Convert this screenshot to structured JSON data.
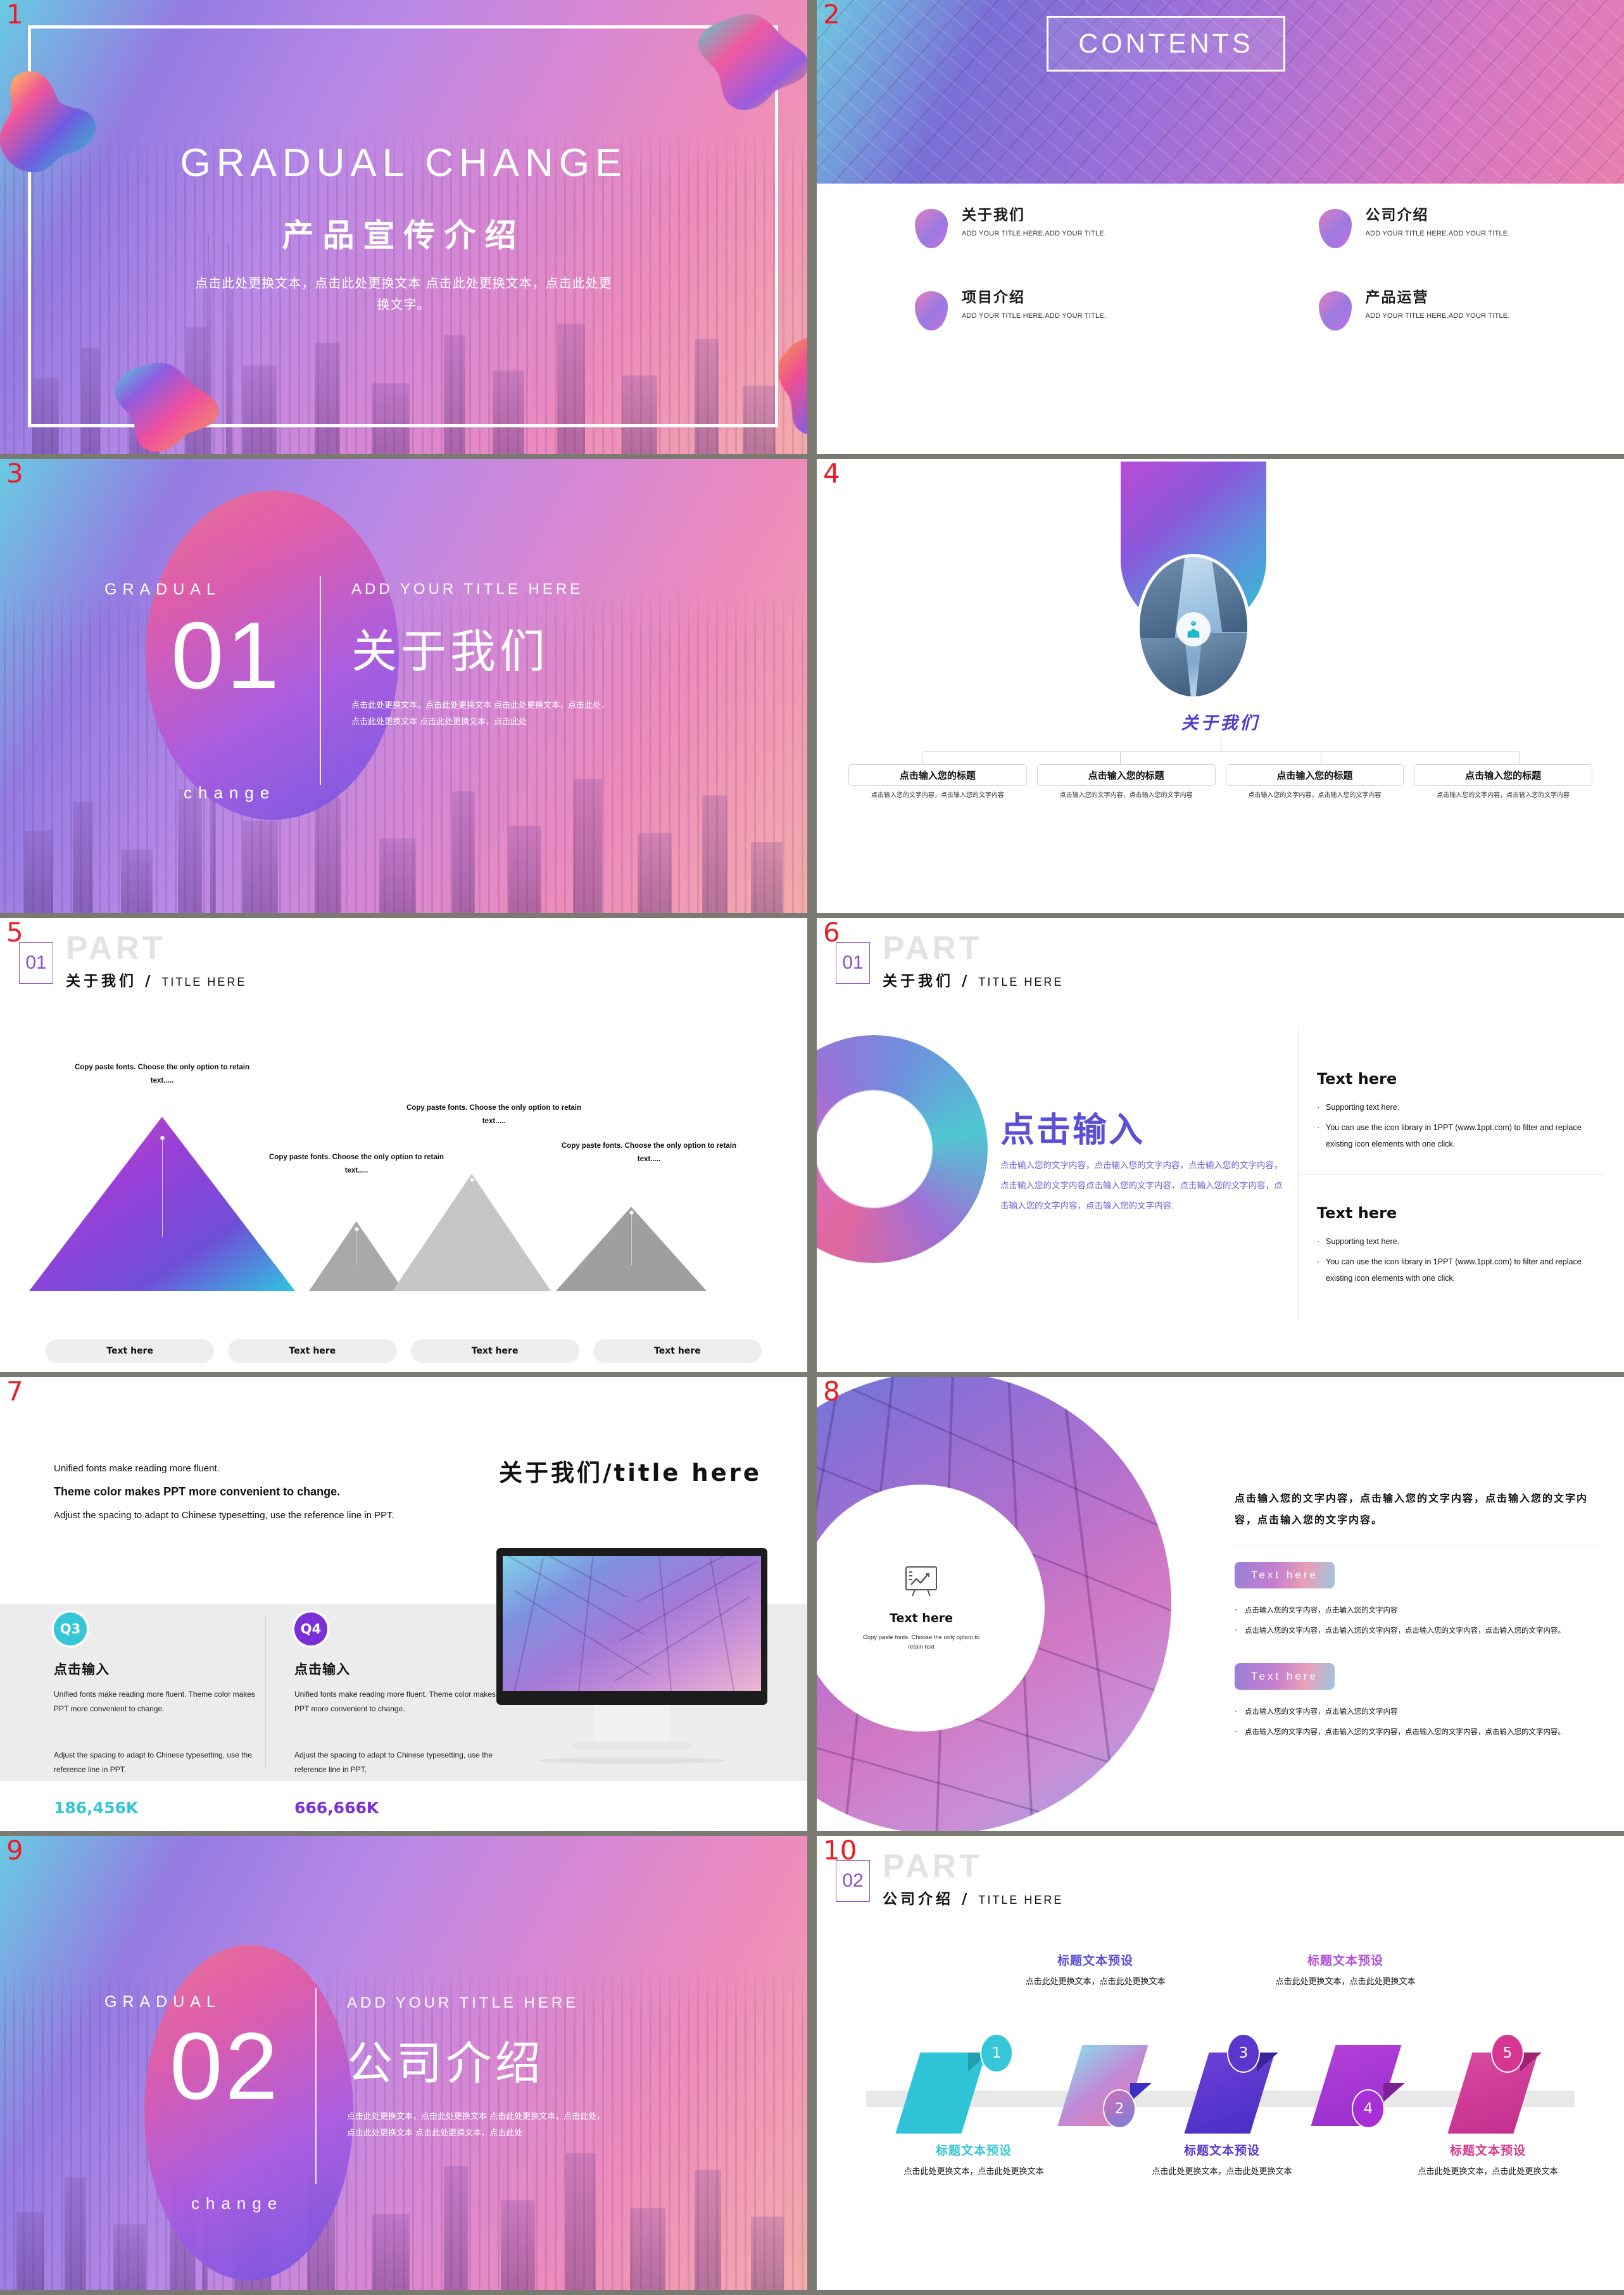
{
  "meta": {
    "slide_numbers": [
      "1",
      "2",
      "3",
      "4",
      "5",
      "6",
      "7",
      "8",
      "9",
      "10"
    ],
    "accent_purple": "#8c4fc2",
    "accent_indigo": "#5b4fd6",
    "number_color": "#ec1c24"
  },
  "slide1": {
    "title_en": "GRADUAL CHANGE",
    "title_cn": "产品宣传介绍",
    "desc": "点击此处更换文本，点击此处更换文本 点击此处更换文本，点击此处更换文字。"
  },
  "slide2": {
    "heading": "CONTENTS",
    "items": [
      {
        "title": "关于我们",
        "sub": "ADD YOUR TITLE HERE.ADD YOUR TITLE."
      },
      {
        "title": "公司介绍",
        "sub": "ADD YOUR TITLE HERE.ADD YOUR TITLE."
      },
      {
        "title": "项目介绍",
        "sub": "ADD YOUR TITLE HERE.ADD YOUR TITLE."
      },
      {
        "title": "产品运营",
        "sub": "ADD YOUR TITLE HERE.ADD YOUR TITLE."
      }
    ]
  },
  "slide3": {
    "gradual": "GRADUAL",
    "number": "01",
    "change": "change",
    "add_title": "ADD YOUR TITLE HERE",
    "title_cn": "关于我们",
    "desc_line1": "点击此处更换文本，点击此处更换文本 点击此处更换文本，点击此处，",
    "desc_line2": "点击此处更换文本 点击此处更换文本，点击此处"
  },
  "slide4": {
    "title_cn": "关于我们",
    "cards": [
      {
        "head": "点击输入您的标题",
        "text": "点击输入您的文字内容，点击输入您的文字内容"
      },
      {
        "head": "点击输入您的标题",
        "text": "点击输入您的文字内容，点击输入您的文字内容"
      },
      {
        "head": "点击输入您的标题",
        "text": "点击输入您的文字内容，点击输入您的文字内容"
      },
      {
        "head": "点击输入您的标题",
        "text": "点击输入您的文字内容，点击输入您的文字内容"
      }
    ]
  },
  "slide5": {
    "part_word": "PART",
    "part_num": "01",
    "part_cn": "关于我们",
    "part_en": "TITLE HERE",
    "notes": [
      "Copy paste fonts. Choose the only option to retain text.....",
      "Copy paste fonts. Choose the only option to retain text.....",
      "Copy paste fonts. Choose the only option to retain text.....",
      "Copy paste fonts. Choose the only option to retain text....."
    ],
    "buttons": [
      "Text here",
      "Text here",
      "Text here",
      "Text here"
    ],
    "chart_data": {
      "type": "bar",
      "title": "",
      "categories": [
        "Text here",
        "Text here",
        "Text here",
        "Text here"
      ],
      "values": [
        100,
        38,
        70,
        45
      ],
      "series": [
        {
          "name": "Mountains",
          "values": [
            100,
            38,
            70,
            45
          ]
        }
      ],
      "value_labels": [
        "Copy paste fonts. Choose the only option to retain text.....",
        "Copy paste fonts. Choose the only option to retain text.....",
        "Copy paste fonts. Choose the only option to retain text.....",
        "Copy paste fonts. Choose the only option to retain text....."
      ],
      "colors": [
        "gradient-purple-cyan",
        "#a8a8a8",
        "#c4c4c4",
        "#9e9e9e"
      ],
      "xlabel": "",
      "ylabel": "",
      "ylim": [
        0,
        100
      ],
      "grid": false,
      "legend": "none"
    }
  },
  "slide6": {
    "part_word": "PART",
    "part_num": "01",
    "part_cn": "关于我们",
    "part_en": "TITLE HERE",
    "headline_cn": "点击输入",
    "body_cn": "点击输入您的文字内容，点击输入您的文字内容，点击输入您的文字内容，点击输入您的文字内容点击输入您的文字内容，点击输入您的文字内容，点击输入您的文字内容，点击输入您的文字内容.",
    "blocks": [
      {
        "head": "Text here",
        "bullets": [
          "Supporting text here.",
          "You can use the icon library in 1PPT (www.1ppt.com) to filter and replace existing icon elements with one click."
        ]
      },
      {
        "head": "Text here",
        "bullets": [
          "Supporting text here.",
          "You can use the icon library in 1PPT (www.1ppt.com) to filter and replace existing icon elements with one click."
        ]
      }
    ]
  },
  "slide7": {
    "line1": "Unified fonts make reading more fluent.",
    "line2": "Theme color makes PPT more convenient to change.",
    "line3": "Adjust the spacing to adapt to Chinese typesetting, use the reference line in PPT.",
    "title": "关于我们/title here",
    "columns": [
      {
        "badge": "Q3",
        "badge_color": "#35c6d8",
        "head": "点击输入",
        "text": "Unified fonts make reading more fluent. Theme color makes PPT more convenient to change.",
        "text2": "Adjust the spacing to adapt to Chinese typesetting, use the reference line in PPT.",
        "number": "186,456K",
        "number_color": "#35c6d8"
      },
      {
        "badge": "Q4",
        "badge_color": "#7b2fd6",
        "head": "点击输入",
        "text": "Unified fonts make reading more fluent. Theme color makes PPT more convenient to change.",
        "text2": "Adjust the spacing to adapt to Chinese typesetting, use the reference line in PPT.",
        "number": "666,666K",
        "number_color": "#7b2fd6"
      }
    ]
  },
  "slide8": {
    "circle_title": "Text here",
    "circle_text": "Copy paste fonts. Choose the only option to retain text",
    "lead": "点击输入您的文字内容，点击输入您的文字内容，点击输入您的文字内容，点击输入您的文字内容。",
    "blocks": [
      {
        "chip": "Text here",
        "bullets": [
          "点击输入您的文字内容，点击输入您的文字内容",
          "点击输入您的文字内容，点击输入您的文字内容，点击输入您的文字内容，点击输入您的文字内容。"
        ]
      },
      {
        "chip": "Text here",
        "bullets": [
          "点击输入您的文字内容，点击输入您的文字内容",
          "点击输入您的文字内容，点击输入您的文字内容，点击输入您的文字内容，点击输入您的文字内容。"
        ]
      }
    ]
  },
  "slide9": {
    "gradual": "GRADUAL",
    "number": "02",
    "change": "change",
    "add_title": "ADD YOUR TITLE HERE",
    "title_cn": "公司介绍",
    "desc_line1": "点击此处更换文本，点击此处更换文本 点击此处更换文本，点击此处，",
    "desc_line2": "点击此处更换文本 点击此处更换文本，点击此处"
  },
  "slide10": {
    "part_word": "PART",
    "part_num": "02",
    "part_cn": "公司介绍",
    "part_en": "TITLE HERE",
    "steps": [
      {
        "num": "1",
        "label": "标题文本预设",
        "text": "点击此处更换文本，点击此处更换文本",
        "color": "#35c6d8",
        "position": "below"
      },
      {
        "num": "2",
        "label": "标题文本预设",
        "text": "点击此处更换文本，点击此处更换文本",
        "color": "#a07ad8",
        "position": "above"
      },
      {
        "num": "3",
        "label": "标题文本预设",
        "text": "点击此处更换文本，点击此处更换文本",
        "color": "#5b36cf",
        "position": "below"
      },
      {
        "num": "4",
        "label": "标题文本预设",
        "text": "点击此处更换文本，点击此处更换文本",
        "color": "#a82fd6",
        "position": "above"
      },
      {
        "num": "5",
        "label": "标题文本预设",
        "text": "点击此处更换文本，点击此处更换文本",
        "color": "#d6368f",
        "position": "below"
      }
    ]
  }
}
